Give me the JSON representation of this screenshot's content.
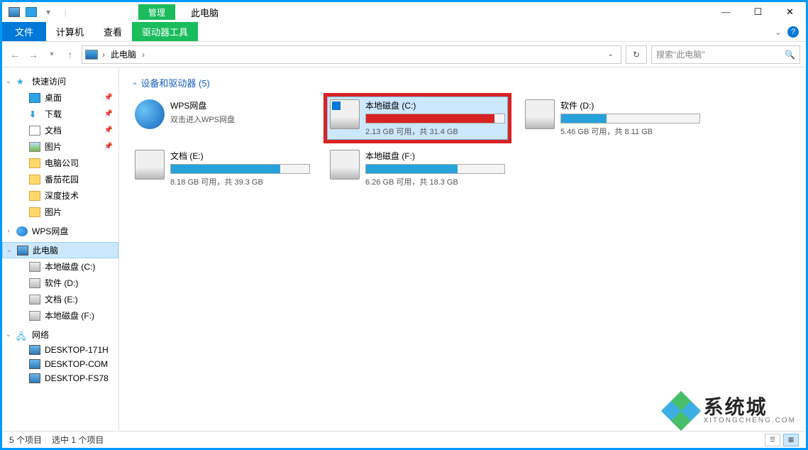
{
  "window": {
    "ribbon_context_mini": "管理",
    "title": "此电脑"
  },
  "ribbon": {
    "file": "文件",
    "tabs": [
      "计算机",
      "查看"
    ],
    "context_tab": "驱动器工具"
  },
  "addressbar": {
    "root": "此电脑",
    "search_placeholder": "搜索\"此电脑\""
  },
  "sidebar": {
    "quick": {
      "label": "快速访问",
      "items": [
        {
          "label": "桌面",
          "pinned": true,
          "icon": "desktop"
        },
        {
          "label": "下载",
          "pinned": true,
          "icon": "download"
        },
        {
          "label": "文档",
          "pinned": true,
          "icon": "doc"
        },
        {
          "label": "图片",
          "pinned": true,
          "icon": "pic"
        },
        {
          "label": "电脑公司",
          "pinned": false,
          "icon": "folder"
        },
        {
          "label": "番茄花园",
          "pinned": false,
          "icon": "folder"
        },
        {
          "label": "深度技术",
          "pinned": false,
          "icon": "folder"
        },
        {
          "label": "图片",
          "pinned": false,
          "icon": "folder"
        }
      ]
    },
    "wps": {
      "label": "WPS网盘"
    },
    "thispc": {
      "label": "此电脑",
      "drives": [
        {
          "label": "本地磁盘 (C:)"
        },
        {
          "label": "软件 (D:)"
        },
        {
          "label": "文档 (E:)"
        },
        {
          "label": "本地磁盘 (F:)"
        }
      ]
    },
    "network": {
      "label": "网络",
      "items": [
        "DESKTOP-171H",
        "DESKTOP-COM",
        "DESKTOP-FS78"
      ]
    }
  },
  "content": {
    "section_title": "设备和驱动器 (5)",
    "items": [
      {
        "name": "WPS网盘",
        "sub": "双击进入WPS网盘",
        "type": "wps"
      },
      {
        "name": "本地磁盘 (C:)",
        "sub": "2.13 GB 可用，共 31.4 GB",
        "type": "os",
        "fill_pct": 93,
        "fill_color": "red",
        "selected": true,
        "highlighted": true
      },
      {
        "name": "软件 (D:)",
        "sub": "5.46 GB 可用，共 8.11 GB",
        "type": "disk",
        "fill_pct": 33,
        "fill_color": "blue"
      },
      {
        "name": "文档 (E:)",
        "sub": "8.18 GB 可用，共 39.3 GB",
        "type": "disk",
        "fill_pct": 79,
        "fill_color": "blue"
      },
      {
        "name": "本地磁盘 (F:)",
        "sub": "6.26 GB 可用，共 18.3 GB",
        "type": "disk",
        "fill_pct": 66,
        "fill_color": "blue"
      }
    ]
  },
  "statusbar": {
    "count": "5 个项目",
    "selection": "选中 1 个项目"
  },
  "watermark": {
    "big": "系统城",
    "small": "XITONGCHENG.COM"
  }
}
